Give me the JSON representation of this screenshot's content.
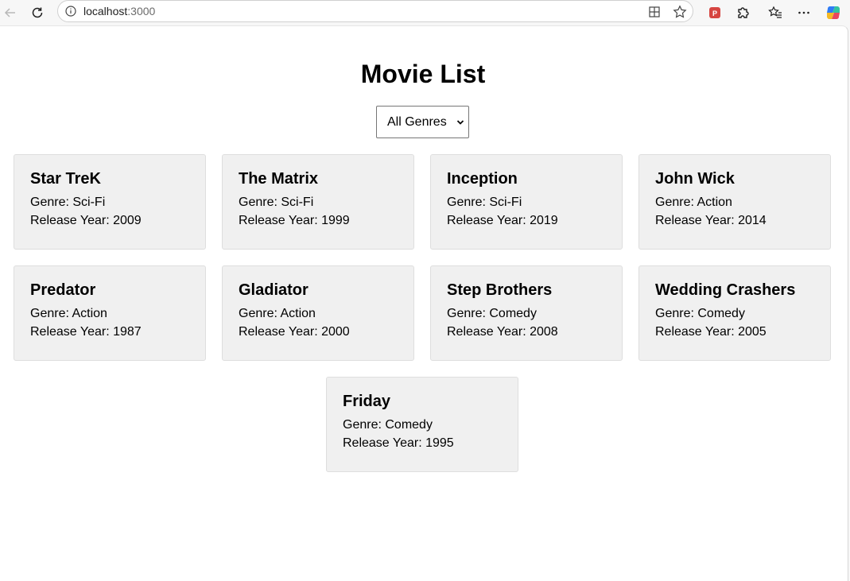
{
  "browser": {
    "url_host": "localhost",
    "url_port": ":3000",
    "icons": {
      "back": "back-arrow-icon",
      "reload": "reload-icon",
      "info": "info-icon",
      "split": "split-screen-icon",
      "favorite": "star-icon",
      "pdf_ext": "pdf-extension-icon",
      "extensions": "puzzle-icon",
      "favorites": "favorites-list-icon",
      "more": "more-icon",
      "copilot": "copilot-icon"
    }
  },
  "page": {
    "title": "Movie List",
    "filter": {
      "selected": "All Genres"
    },
    "movies": [
      {
        "title": "Star TreK",
        "genre": "Genre: Sci-Fi",
        "year": "Release Year: 2009"
      },
      {
        "title": "The Matrix",
        "genre": "Genre: Sci-Fi",
        "year": "Release Year: 1999"
      },
      {
        "title": "Inception",
        "genre": "Genre: Sci-Fi",
        "year": "Release Year: 2019"
      },
      {
        "title": "John Wick",
        "genre": "Genre: Action",
        "year": "Release Year: 2014"
      },
      {
        "title": "Predator",
        "genre": "Genre: Action",
        "year": "Release Year: 1987"
      },
      {
        "title": "Gladiator",
        "genre": "Genre: Action",
        "year": "Release Year: 2000"
      },
      {
        "title": "Step Brothers",
        "genre": "Genre: Comedy",
        "year": "Release Year: 2008"
      },
      {
        "title": "Wedding Crashers",
        "genre": "Genre: Comedy",
        "year": "Release Year: 2005"
      },
      {
        "title": "Friday",
        "genre": "Genre: Comedy",
        "year": "Release Year: 1995"
      }
    ]
  }
}
